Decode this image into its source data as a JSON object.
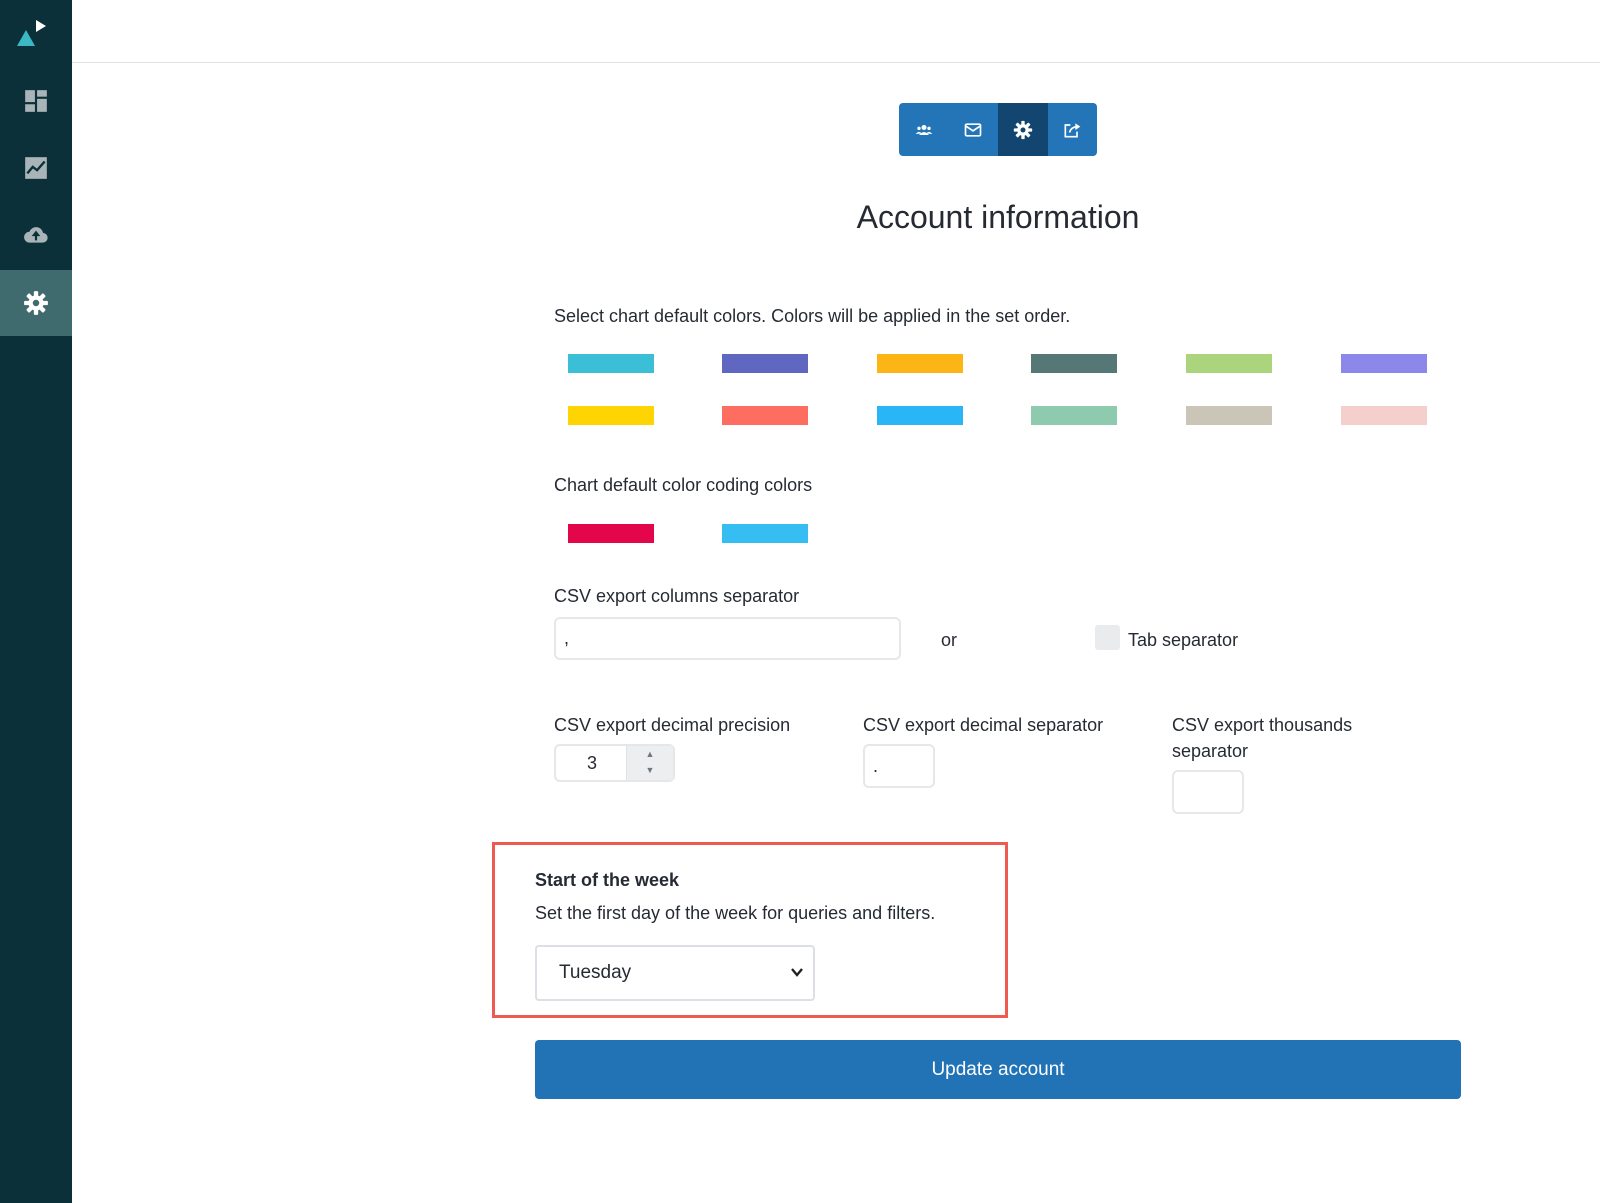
{
  "toolbar": {
    "icons": [
      "users-icon",
      "mail-icon",
      "gear-icon",
      "share-icon"
    ],
    "active": "gear-icon"
  },
  "sidebar": {
    "items": [
      "dashboard-icon",
      "chart-icon",
      "cloud-upload-icon",
      "gear-icon"
    ],
    "active": "gear-icon"
  },
  "page": {
    "title": "Account information"
  },
  "colors_section": {
    "label": "Select chart default colors. Colors will be applied in the set order.",
    "colors": [
      "#3abfd6",
      "#5f67c0",
      "#fbb515",
      "#557877",
      "#abd57c",
      "#8c88ea",
      "#fed503",
      "#fd6e61",
      "#2ab5f6",
      "#8ecaae",
      "#cbc5b8",
      "#f5cfcc"
    ]
  },
  "coding_section": {
    "label": "Chart default color coding colors",
    "colors": [
      "#e4064b",
      "#36bdf2"
    ]
  },
  "csv_separator": {
    "label": "CSV export columns separator",
    "value": ",",
    "or_text": "or",
    "tab_label": "Tab separator",
    "tab_checked": false
  },
  "csv_precision": {
    "label": "CSV export decimal precision",
    "value": "3"
  },
  "csv_decimal": {
    "label": "CSV export decimal separator",
    "value": "."
  },
  "csv_thousands": {
    "label_line1": "CSV export thousands",
    "label_line2": "separator",
    "value": ""
  },
  "week": {
    "title": "Start of the week",
    "description": "Set the first day of the week for queries and filters.",
    "selected": "Tuesday"
  },
  "update_button": "Update account",
  "theme": {
    "sidebar_bg": "#0b3039",
    "accent": "#2173b5",
    "highlight": "#ee5a4f"
  }
}
